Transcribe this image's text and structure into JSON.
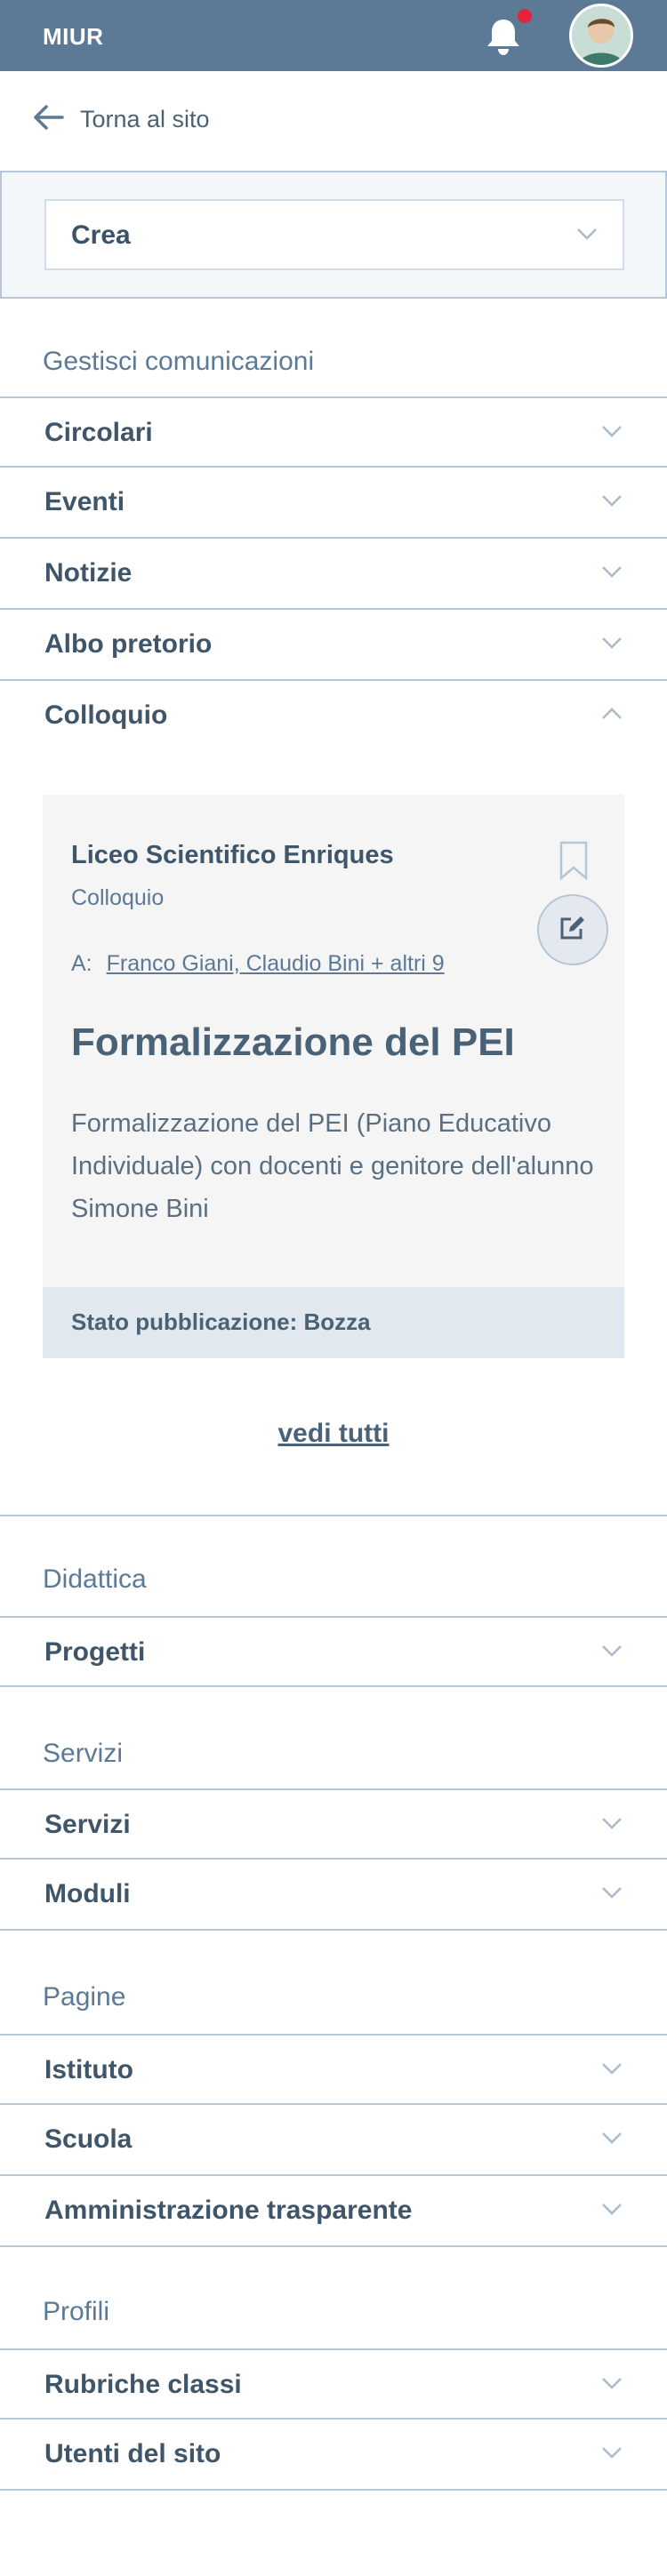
{
  "topbar": {
    "brand": "MIUR",
    "notification_dot_color": "#e5243b"
  },
  "back": {
    "label": "Torna al sito"
  },
  "create": {
    "selected": "Crea"
  },
  "sections": {
    "comunicazioni": {
      "title": "Gestisci comunicazioni",
      "items": [
        "Circolari",
        "Eventi",
        "Notizie",
        "Albo pretorio",
        "Colloquio"
      ]
    },
    "didattica": {
      "title": "Didattica",
      "items": [
        "Progetti"
      ]
    },
    "servizi": {
      "title": "Servizi",
      "items": [
        "Servizi",
        "Moduli"
      ]
    },
    "pagine": {
      "title": "Pagine",
      "items": [
        "Istituto",
        "Scuola",
        "Amministrazione trasparente"
      ]
    },
    "profili": {
      "title": "Profili",
      "items": [
        "Rubriche classi",
        "Utenti del sito"
      ]
    }
  },
  "card": {
    "school": "Liceo Scientifico Enriques",
    "type": "Colloquio",
    "to_label": "A:",
    "recipients": "Franco Giani, Claudio Bini + altri 9",
    "title": "Formalizzazione del PEI",
    "description": "Formalizzazione del PEI (Piano Educativo Individuale) con docenti e genitore dell'alunno Simone Bini",
    "status": "Stato pubblicazione: Bozza"
  },
  "see_all": "vedi tutti",
  "icons": {
    "back": "arrow-left-icon",
    "bell": "bell-icon",
    "chevron_down": "chevron-down-icon",
    "chevron_up": "chevron-up-icon",
    "bookmark": "bookmark-icon",
    "edit": "edit-icon"
  }
}
